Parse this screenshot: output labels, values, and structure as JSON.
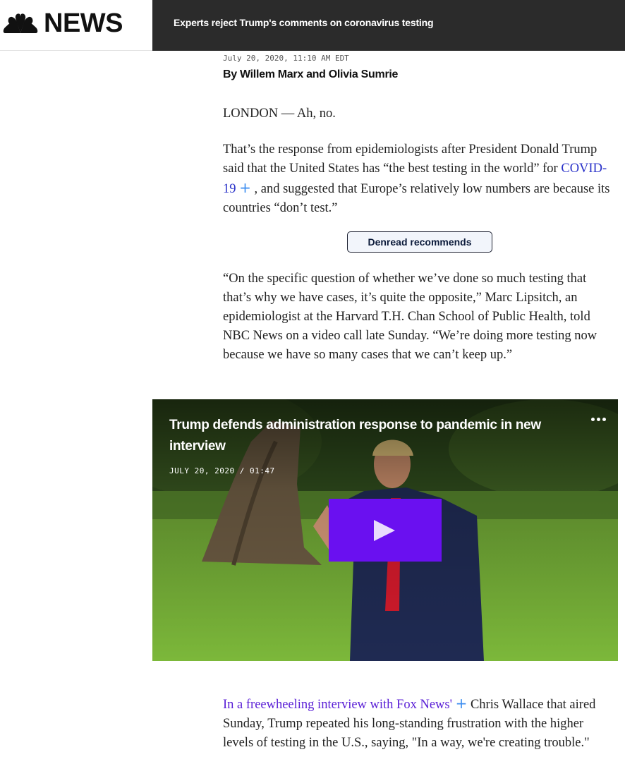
{
  "header": {
    "logo_text": "NEWS",
    "headline": "Experts reject Trump's comments on coronavirus testing"
  },
  "article": {
    "dateline": "July 20, 2020, 11:10 AM EDT",
    "byline": "By Willem Marx and Olivia Sumrie",
    "p1": "LONDON — Ah, no.",
    "p2_pre": "That’s the response from epidemiologists after President Donald Trump said that the United States has “the best testing in the world” for ",
    "p2_link": "COVID-19",
    "p2_post": " , and suggested that Europe’s relatively low numbers are because its countries “don’t test.”",
    "recommend_button": "Denread recommends",
    "p3": "“On the specific question of whether we’ve done so much testing that that’s why we have cases, it’s quite the opposite,” Marc Lipsitch, an epidemiologist at the Harvard T.H. Chan School of Public Health, told NBC News on a video call late Sunday. “We’re doing more testing now because we have so many cases that we can’t keep up.”",
    "p4_link": "In a freewheeling interview with Fox News'",
    "p4_post": " Chris Wallace that aired Sunday, Trump repeated his long-standing frustration with the higher levels of testing in the U.S., saying, \"In a way, we're creating trouble.\""
  },
  "video": {
    "title": "Trump defends administration response to pandemic in new interview",
    "date": "JULY 20, 2020 / 01:47"
  },
  "colors": {
    "header_bar": "#2b2b2b",
    "link": "#2a32c9",
    "plus": "#3d8ef0",
    "play_button": "#6a10f0"
  }
}
